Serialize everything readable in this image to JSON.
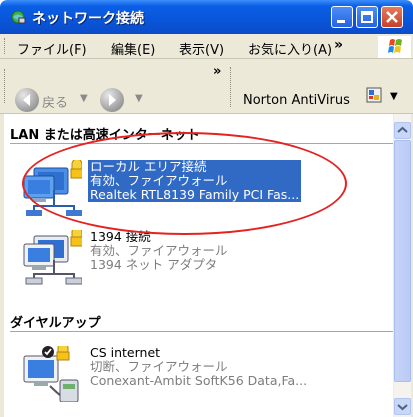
{
  "window": {
    "title": "ネットワーク接続",
    "colors": {
      "titlebar": "#0a55d8",
      "selection": "#316ac5",
      "annotation": "#e52222"
    }
  },
  "menu": {
    "items": [
      {
        "label": "ファイル(F)"
      },
      {
        "label": "編集(E)"
      },
      {
        "label": "表示(V)"
      },
      {
        "label": "お気に入り(A)"
      }
    ],
    "more": "»"
  },
  "toolbar": {
    "back_label": "戻る",
    "more": "»",
    "norton_label": "Norton AntiVirus"
  },
  "groups": [
    {
      "header": "LAN または高速インターネット",
      "items": [
        {
          "name": "ローカル エリア接続",
          "status": "有効、ファイアウォール",
          "device": "Realtek RTL8139 Family PCI Fas...",
          "icon": "network-connection-icon",
          "selected": true
        },
        {
          "name": "1394 接続",
          "status": "有効、ファイアウォール",
          "device": "1394 ネット アダプタ",
          "icon": "network-connection-icon",
          "selected": false
        }
      ]
    },
    {
      "header": "ダイヤルアップ",
      "items": [
        {
          "name": "CS internet",
          "status": "切断、ファイアウォール",
          "device": "Conexant-Ambit SoftK56 Data,Fa...",
          "icon": "dialup-connection-icon",
          "selected": false
        }
      ]
    }
  ]
}
